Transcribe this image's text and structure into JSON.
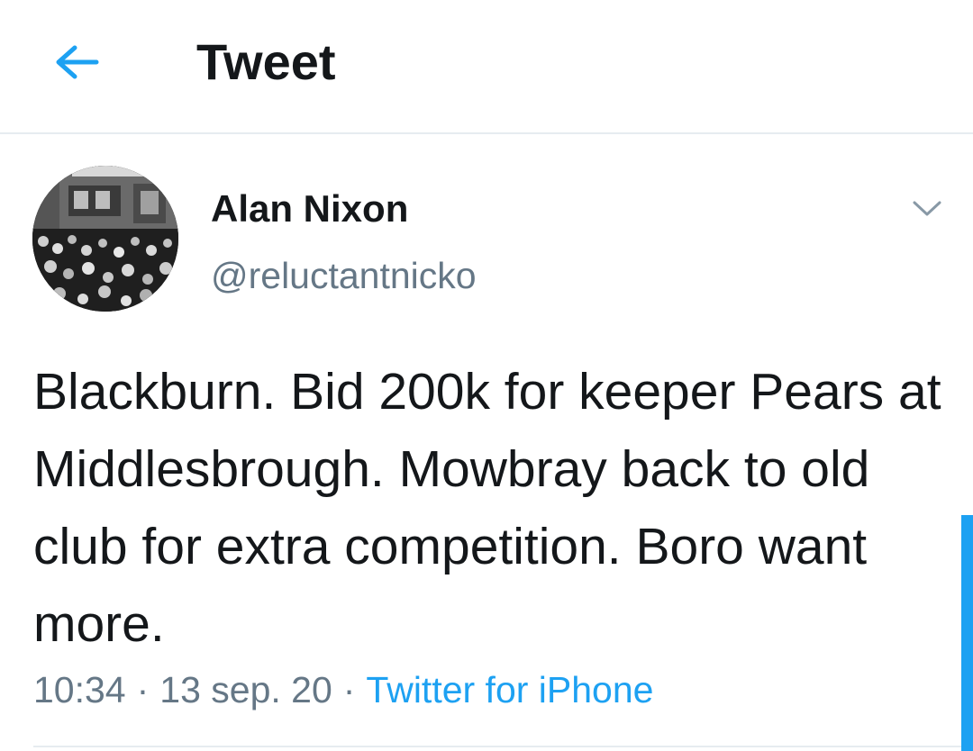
{
  "header": {
    "back_icon": "arrow-left-icon",
    "title": "Tweet"
  },
  "tweet": {
    "author_name": "Alan Nixon",
    "author_handle": "@reluctantnicko",
    "menu_icon": "chevron-down-icon",
    "text": "Blackburn. Bid 200k for keeper Pears at Middlesbrough. Mowbray back to old club for extra competition. Boro want more.",
    "time": "10:34",
    "date": "13 sep. 20",
    "separator": "·",
    "source": "Twitter for iPhone"
  },
  "colors": {
    "accent": "#1da1f2",
    "text_primary": "#14171a",
    "text_secondary": "#657786",
    "divider": "#e6ecf0"
  }
}
